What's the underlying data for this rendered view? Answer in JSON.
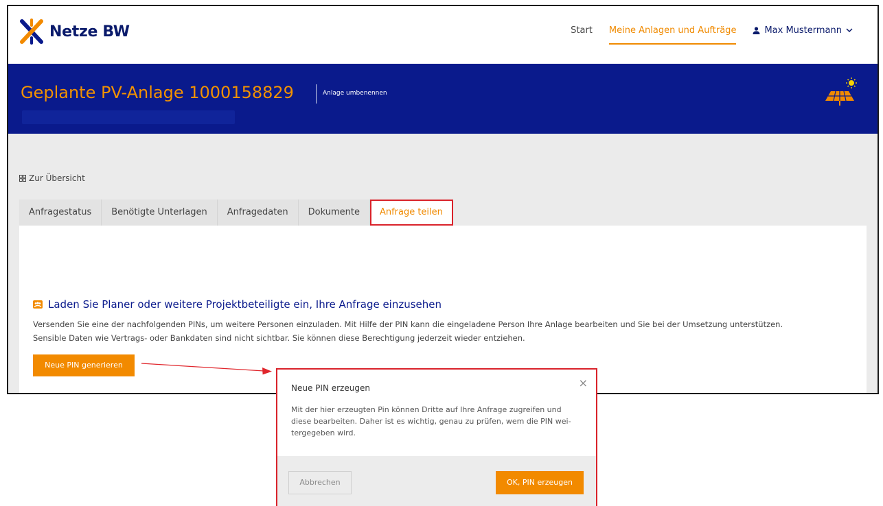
{
  "header": {
    "brand": "Netze BW",
    "nav": [
      {
        "label": "Start"
      },
      {
        "label": "Meine Anlagen und Aufträge"
      }
    ],
    "user": "Max Mustermann"
  },
  "hero": {
    "title": "Geplante PV-Anlage 1000158829",
    "rename_label": "Anlage umbenennen"
  },
  "overview_link": "Zur Übersicht",
  "tabs": [
    {
      "label": "Anfragestatus"
    },
    {
      "label": "Benötigte Unterlagen"
    },
    {
      "label": "Anfragedaten"
    },
    {
      "label": "Dokumente"
    },
    {
      "label": "Anfrage teilen"
    }
  ],
  "content": {
    "title": "Laden Sie Planer oder weitere Projektbeteiligte ein, Ihre Anfrage einzusehen",
    "text_line1": "Versenden Sie eine der nachfolgenden PINs, um weitere Personen einzuladen. Mit Hilfe der PIN kann die eingeladene Person  Ihre Anlage bearbeiten und Sie bei der Umsetzung unterstützen.",
    "text_line2": "Sensible Daten wie Vertrags- oder Bankdaten sind nicht sichtbar. Sie können diese Berechtigung jederzeit wieder entziehen.",
    "button_label": "Neue PIN generieren"
  },
  "modal": {
    "title": "Neue PIN erzeugen",
    "close": "×",
    "text_line1": "Mit der hier erzeugten Pin können Dritte auf Ihre Anfrage zugreifen und",
    "text_line2": "diese bearbeiten. Daher ist es wichtig, genau zu prüfen, wem die PIN wei-",
    "text_line3": "tergegeben wird.",
    "cancel_label": "Abbrechen",
    "ok_label": "OK, PIN erzeugen"
  },
  "colors": {
    "brand_blue": "#0a1a8c",
    "accent_orange": "#f28a00",
    "highlight_red": "#d9222a"
  }
}
